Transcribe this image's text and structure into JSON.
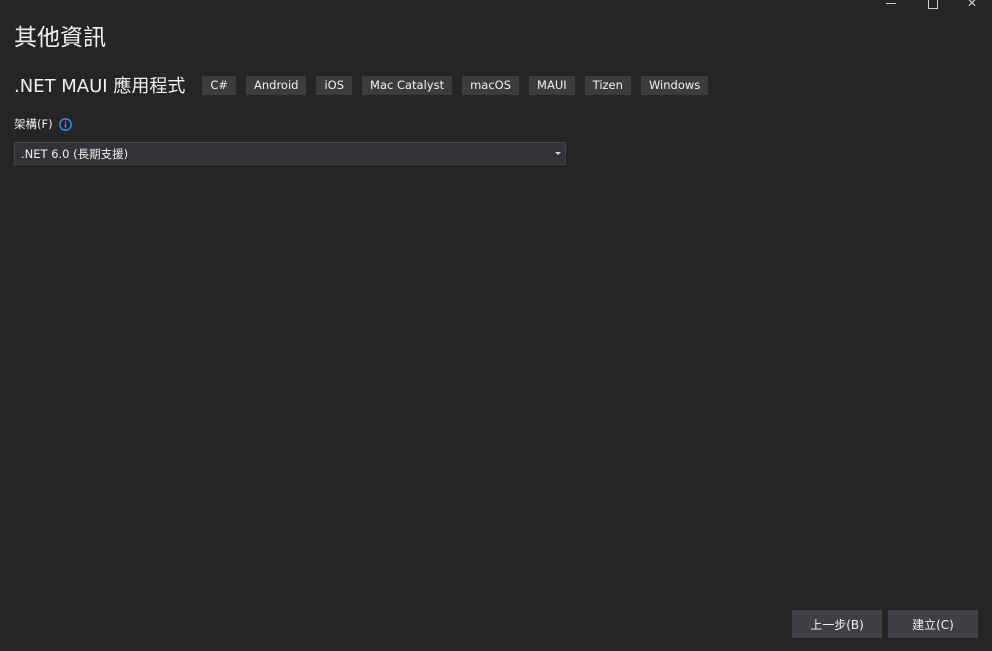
{
  "window": {
    "minimize_icon": "minimize-icon",
    "maximize_icon": "maximize-icon",
    "close_icon": "close-icon",
    "close_glyph": "✕"
  },
  "page": {
    "title": "其他資訊"
  },
  "template": {
    "name": ".NET MAUI 應用程式",
    "tags": [
      "C#",
      "Android",
      "iOS",
      "Mac Catalyst",
      "macOS",
      "MAUI",
      "Tizen",
      "Windows"
    ]
  },
  "framework": {
    "label": "架構(F)",
    "info_icon": "info-icon",
    "selected": ".NET 6.0 (長期支援)"
  },
  "footer": {
    "back_label": "上一步(B)",
    "create_label": "建立(C)"
  },
  "colors": {
    "background": "#252526",
    "tag_background": "#3c3c3c",
    "button_background": "#3f3f46",
    "info_accent": "#3794ff"
  }
}
